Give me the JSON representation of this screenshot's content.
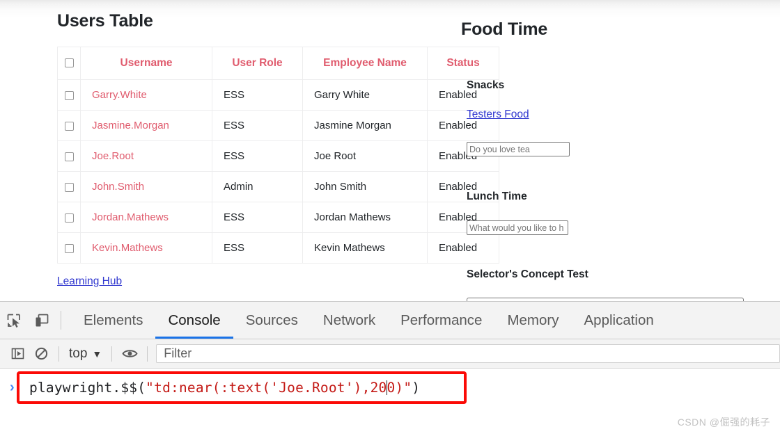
{
  "page": {
    "users_panel": {
      "title": "Users Table",
      "columns": [
        "",
        "Username",
        "User Role",
        "Employee Name",
        "Status"
      ],
      "rows": [
        {
          "username": "Garry.White",
          "role": "ESS",
          "employee": "Garry White",
          "status": "Enabled"
        },
        {
          "username": "Jasmine.Morgan",
          "role": "ESS",
          "employee": "Jasmine Morgan",
          "status": "Enabled"
        },
        {
          "username": "Joe.Root",
          "role": "ESS",
          "employee": "Joe Root",
          "status": "Enabled"
        },
        {
          "username": "John.Smith",
          "role": "Admin",
          "employee": "John Smith",
          "status": "Enabled"
        },
        {
          "username": "Jordan.Mathews",
          "role": "ESS",
          "employee": "Jordan Mathews",
          "status": "Enabled"
        },
        {
          "username": "Kevin.Mathews",
          "role": "ESS",
          "employee": "Kevin Mathews",
          "status": "Enabled"
        }
      ],
      "learning_hub_link": "Learning Hub",
      "header_color": "#e05c6e",
      "link_color": "#2f36cf"
    },
    "food_panel": {
      "title": "Food Time",
      "snacks_label": "Snacks",
      "testers_food_link": "Testers Food",
      "tea_placeholder": "Do you love tea",
      "lunch_label": "Lunch Time",
      "lunch_placeholder": "What would you like to h",
      "selector_label": "Selector's Concept Test",
      "selector_value": ""
    }
  },
  "devtools": {
    "tool_buttons": [
      {
        "name": "inspect-element-icon"
      },
      {
        "name": "device-toolbar-icon"
      }
    ],
    "tabs": [
      {
        "label": "Elements",
        "active": false
      },
      {
        "label": "Console",
        "active": true
      },
      {
        "label": "Sources",
        "active": false
      },
      {
        "label": "Network",
        "active": false
      },
      {
        "label": "Performance",
        "active": false
      },
      {
        "label": "Memory",
        "active": false
      },
      {
        "label": "Application",
        "active": false
      }
    ],
    "active_tab_underline_color": "#1a73e8",
    "filter_bar": {
      "sidebar_toggle_icon": "console-sidebar-icon",
      "clear_console_icon": "clear-console-icon",
      "context": "top",
      "context_caret": "▼",
      "eye_icon": "live-expression-eye-icon",
      "filter_placeholder": "Filter"
    },
    "console": {
      "prompt": "›",
      "code_plain_1": "playwright.$$(",
      "code_quote_open": "\"",
      "code_string_1": "td:near(:text('Joe.Root'),20",
      "code_string_2": "0)",
      "code_quote_close": "\"",
      "code_plain_2": ")",
      "full_command": "playwright.$$(\"td:near(:text('Joe.Root'),200)\")",
      "highlight_box_color": "#fb0a06",
      "string_color": "#c41a16"
    }
  },
  "watermark": "CSDN @倔强的耗子"
}
